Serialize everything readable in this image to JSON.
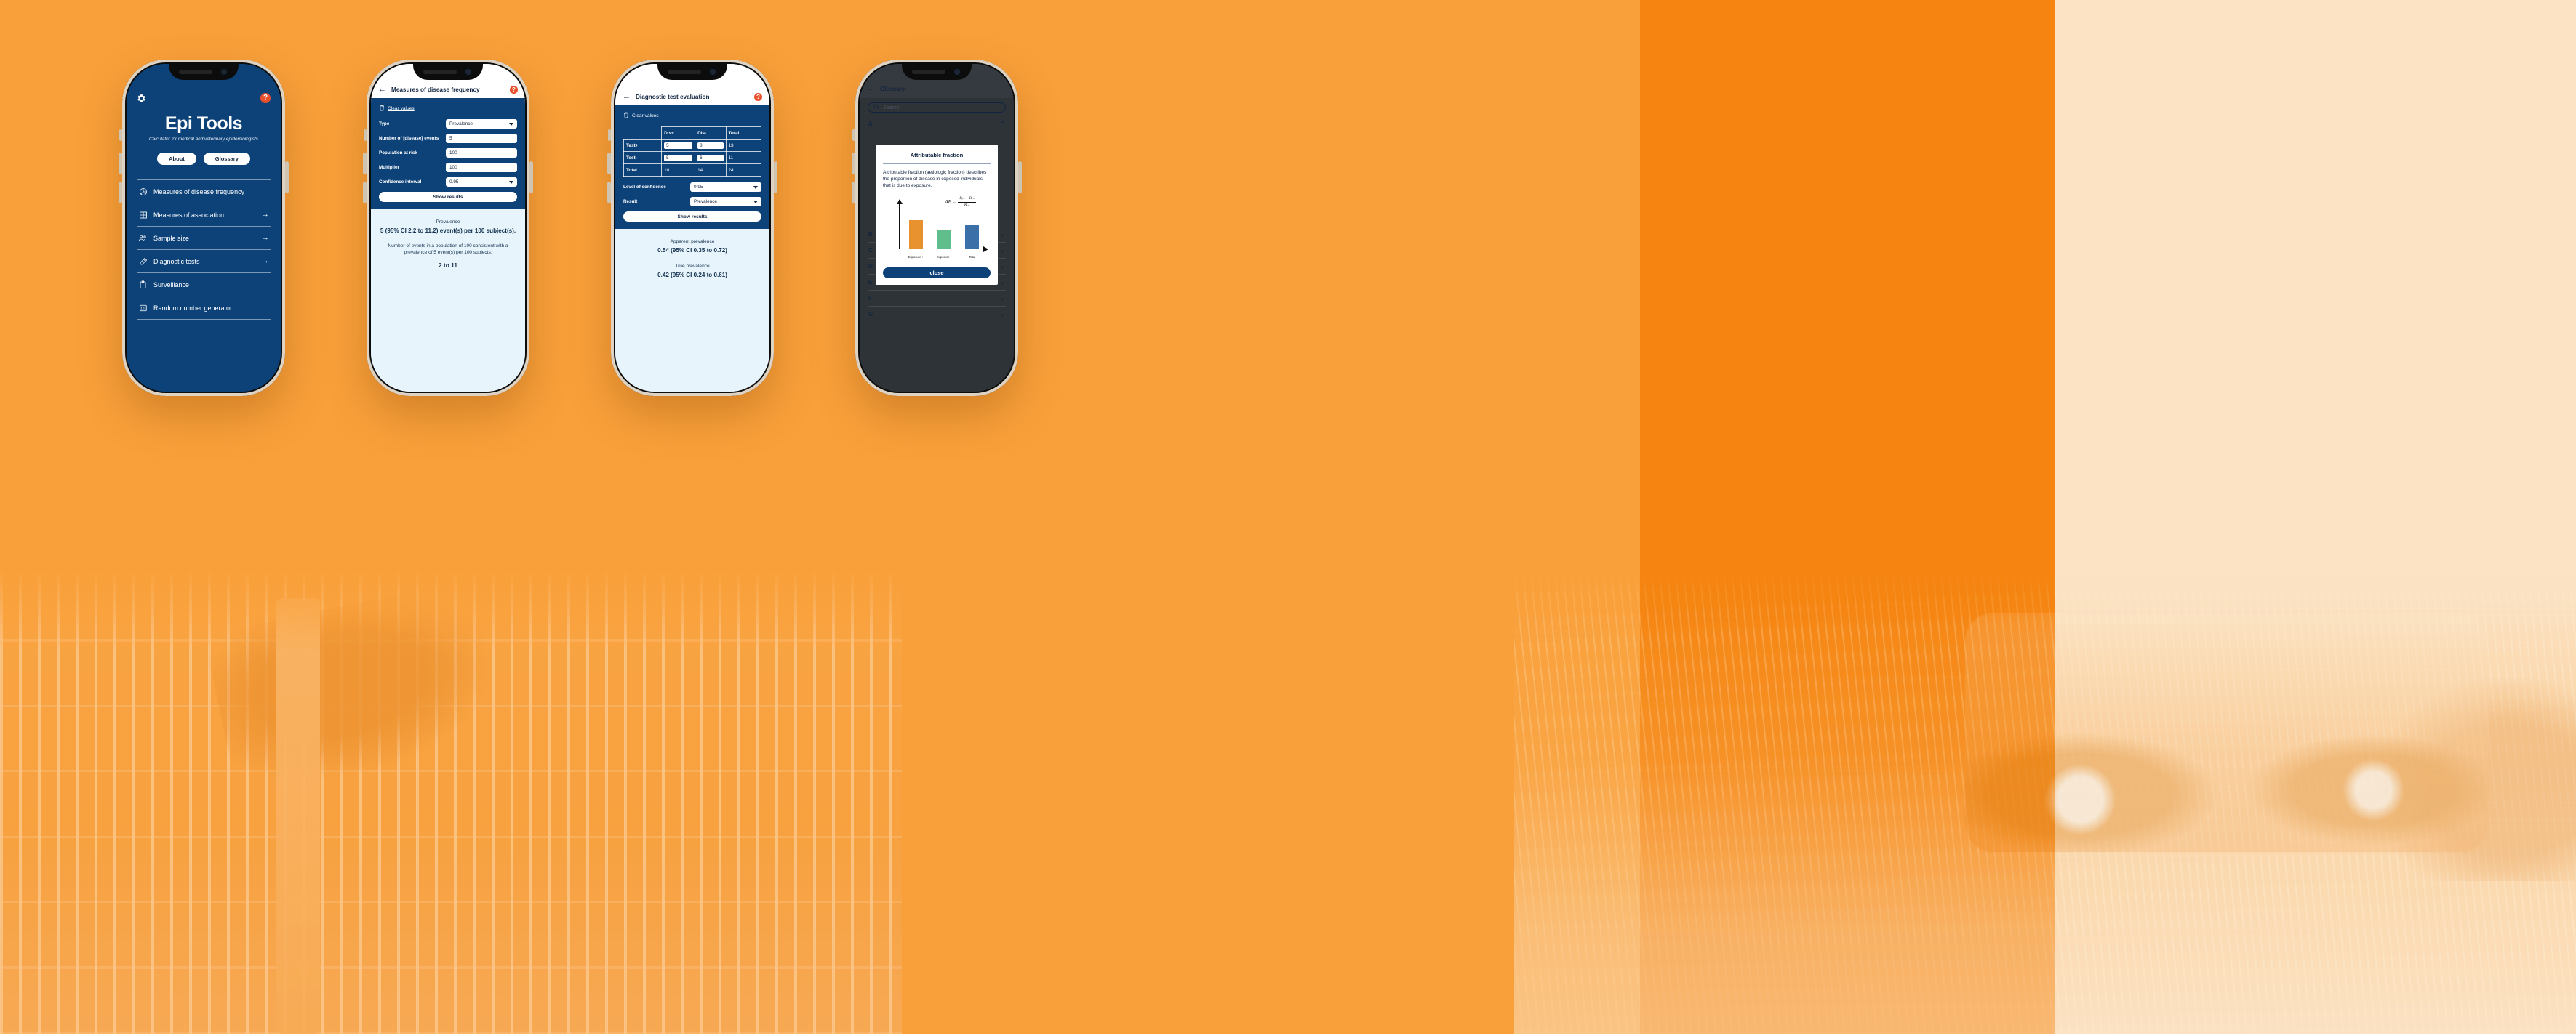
{
  "app": {
    "title": "Epi Tools",
    "subtitle": "Calculator for medical and veterinary epidemiologists",
    "accent_navy": "#0d4279",
    "accent_orange": "#E8502E",
    "background_orange": "#F7941E"
  },
  "home": {
    "gear_icon": "gear-icon",
    "help_icon": "help-icon",
    "help_label": "?",
    "buttons": [
      {
        "label": "About"
      },
      {
        "label": "Glossary"
      }
    ],
    "menu": [
      {
        "label": "Measures of disease frequency",
        "icon": "pie-chart-icon",
        "arrow": ""
      },
      {
        "label": "Measures of association",
        "icon": "table-grid-icon",
        "arrow": "→"
      },
      {
        "label": "Sample size",
        "icon": "people-icon",
        "arrow": "→"
      },
      {
        "label": "Diagnostic tests",
        "icon": "test-tube-icon",
        "arrow": "→"
      },
      {
        "label": "Surveillance",
        "icon": "clipboard-icon",
        "arrow": ""
      },
      {
        "label": "Random number generator",
        "icon": "numbers-123-icon",
        "arrow": ""
      }
    ]
  },
  "frequency": {
    "back_icon": "←",
    "title": "Measures of disease frequency",
    "help_label": "?",
    "clear_label": "Clear values",
    "fields": [
      {
        "label": "Type",
        "value": "Prevalence",
        "kind": "select"
      },
      {
        "label": "Number of [disease] events",
        "value": "5",
        "kind": "input"
      },
      {
        "label": "Population at risk",
        "value": "100",
        "kind": "input"
      },
      {
        "label": "Multiplier",
        "value": "100",
        "kind": "input"
      },
      {
        "label": "Confidence interval",
        "value": "0.95",
        "kind": "select"
      }
    ],
    "show_results_label": "Show results",
    "results": {
      "label": "Prevalence",
      "value": "5 (95% CI 2.2 to 11.2) event(s) per 100 subject(s).",
      "note": "Number of events in a population of 100 consistent with a prevalence of 5 event(s) per 100 subjects:",
      "range": "2 to 11"
    }
  },
  "diagnostic": {
    "back_icon": "←",
    "title": "Diagnostic test evaluation",
    "help_label": "?",
    "clear_label": "Clear values",
    "table": {
      "columns": [
        "Dis+",
        "Dis-",
        "Total"
      ],
      "rows": [
        {
          "header": "Test+",
          "cells": [
            "5",
            "8"
          ],
          "total": "13"
        },
        {
          "header": "Test-",
          "cells": [
            "5",
            "6"
          ],
          "total": "11"
        }
      ],
      "totals_header": "Total",
      "totals": [
        "10",
        "14",
        "24"
      ]
    },
    "fields": [
      {
        "label": "Level of confidence",
        "value": "0.95"
      },
      {
        "label": "Result",
        "value": "Prevalence"
      }
    ],
    "show_results_label": "Show results",
    "results": [
      {
        "label": "Apparent prevalence",
        "value": "0.54 (95% CI 0.35 to 0.72)"
      },
      {
        "label": "True prevalence",
        "value": "0.42 (95% CI 0.24 to 0.61)"
      }
    ]
  },
  "glossary": {
    "back_icon": "←",
    "title": "Glossary",
    "search_placeholder": "Search",
    "search_icon": "search-icon",
    "sections": [
      {
        "letter": "A",
        "chevron": "⌃",
        "expanded": true
      },
      {
        "letter": "B",
        "chevron": "⌄",
        "expanded": false
      },
      {
        "letter": "C",
        "chevron": "⌄",
        "expanded": false
      },
      {
        "letter": "D",
        "chevron": "⌄",
        "expanded": false
      },
      {
        "letter": "E",
        "chevron": "⌄",
        "expanded": false
      },
      {
        "letter": "F",
        "chevron": "⌄",
        "expanded": false
      },
      {
        "letter": "G",
        "chevron": "⌄",
        "expanded": false
      }
    ],
    "modal": {
      "title": "Attributable fraction",
      "body": "Attributable fraction (aetiologic fraction) describes the proportion of disease in exposed individuals that is due to exposure.",
      "formula_lhs": "AF  =",
      "formula_numerator": "Rₑ₊ − Rₑ₋",
      "formula_denominator": "Rₑ₊",
      "close_label": "close"
    }
  },
  "chart_data": {
    "type": "bar",
    "title": "Attributable fraction",
    "categories": [
      "Exposure +",
      "Exposure -",
      "Total"
    ],
    "values": [
      62,
      42,
      52
    ],
    "colors": [
      "#E8912F",
      "#5FBE8C",
      "#3A6FA8"
    ],
    "xlabel": "",
    "ylabel": "",
    "ylim": [
      0,
      100
    ],
    "grid": false,
    "legend": "none",
    "annotation": "AF = (R(E+) - R(E-)) / R(E+)"
  }
}
